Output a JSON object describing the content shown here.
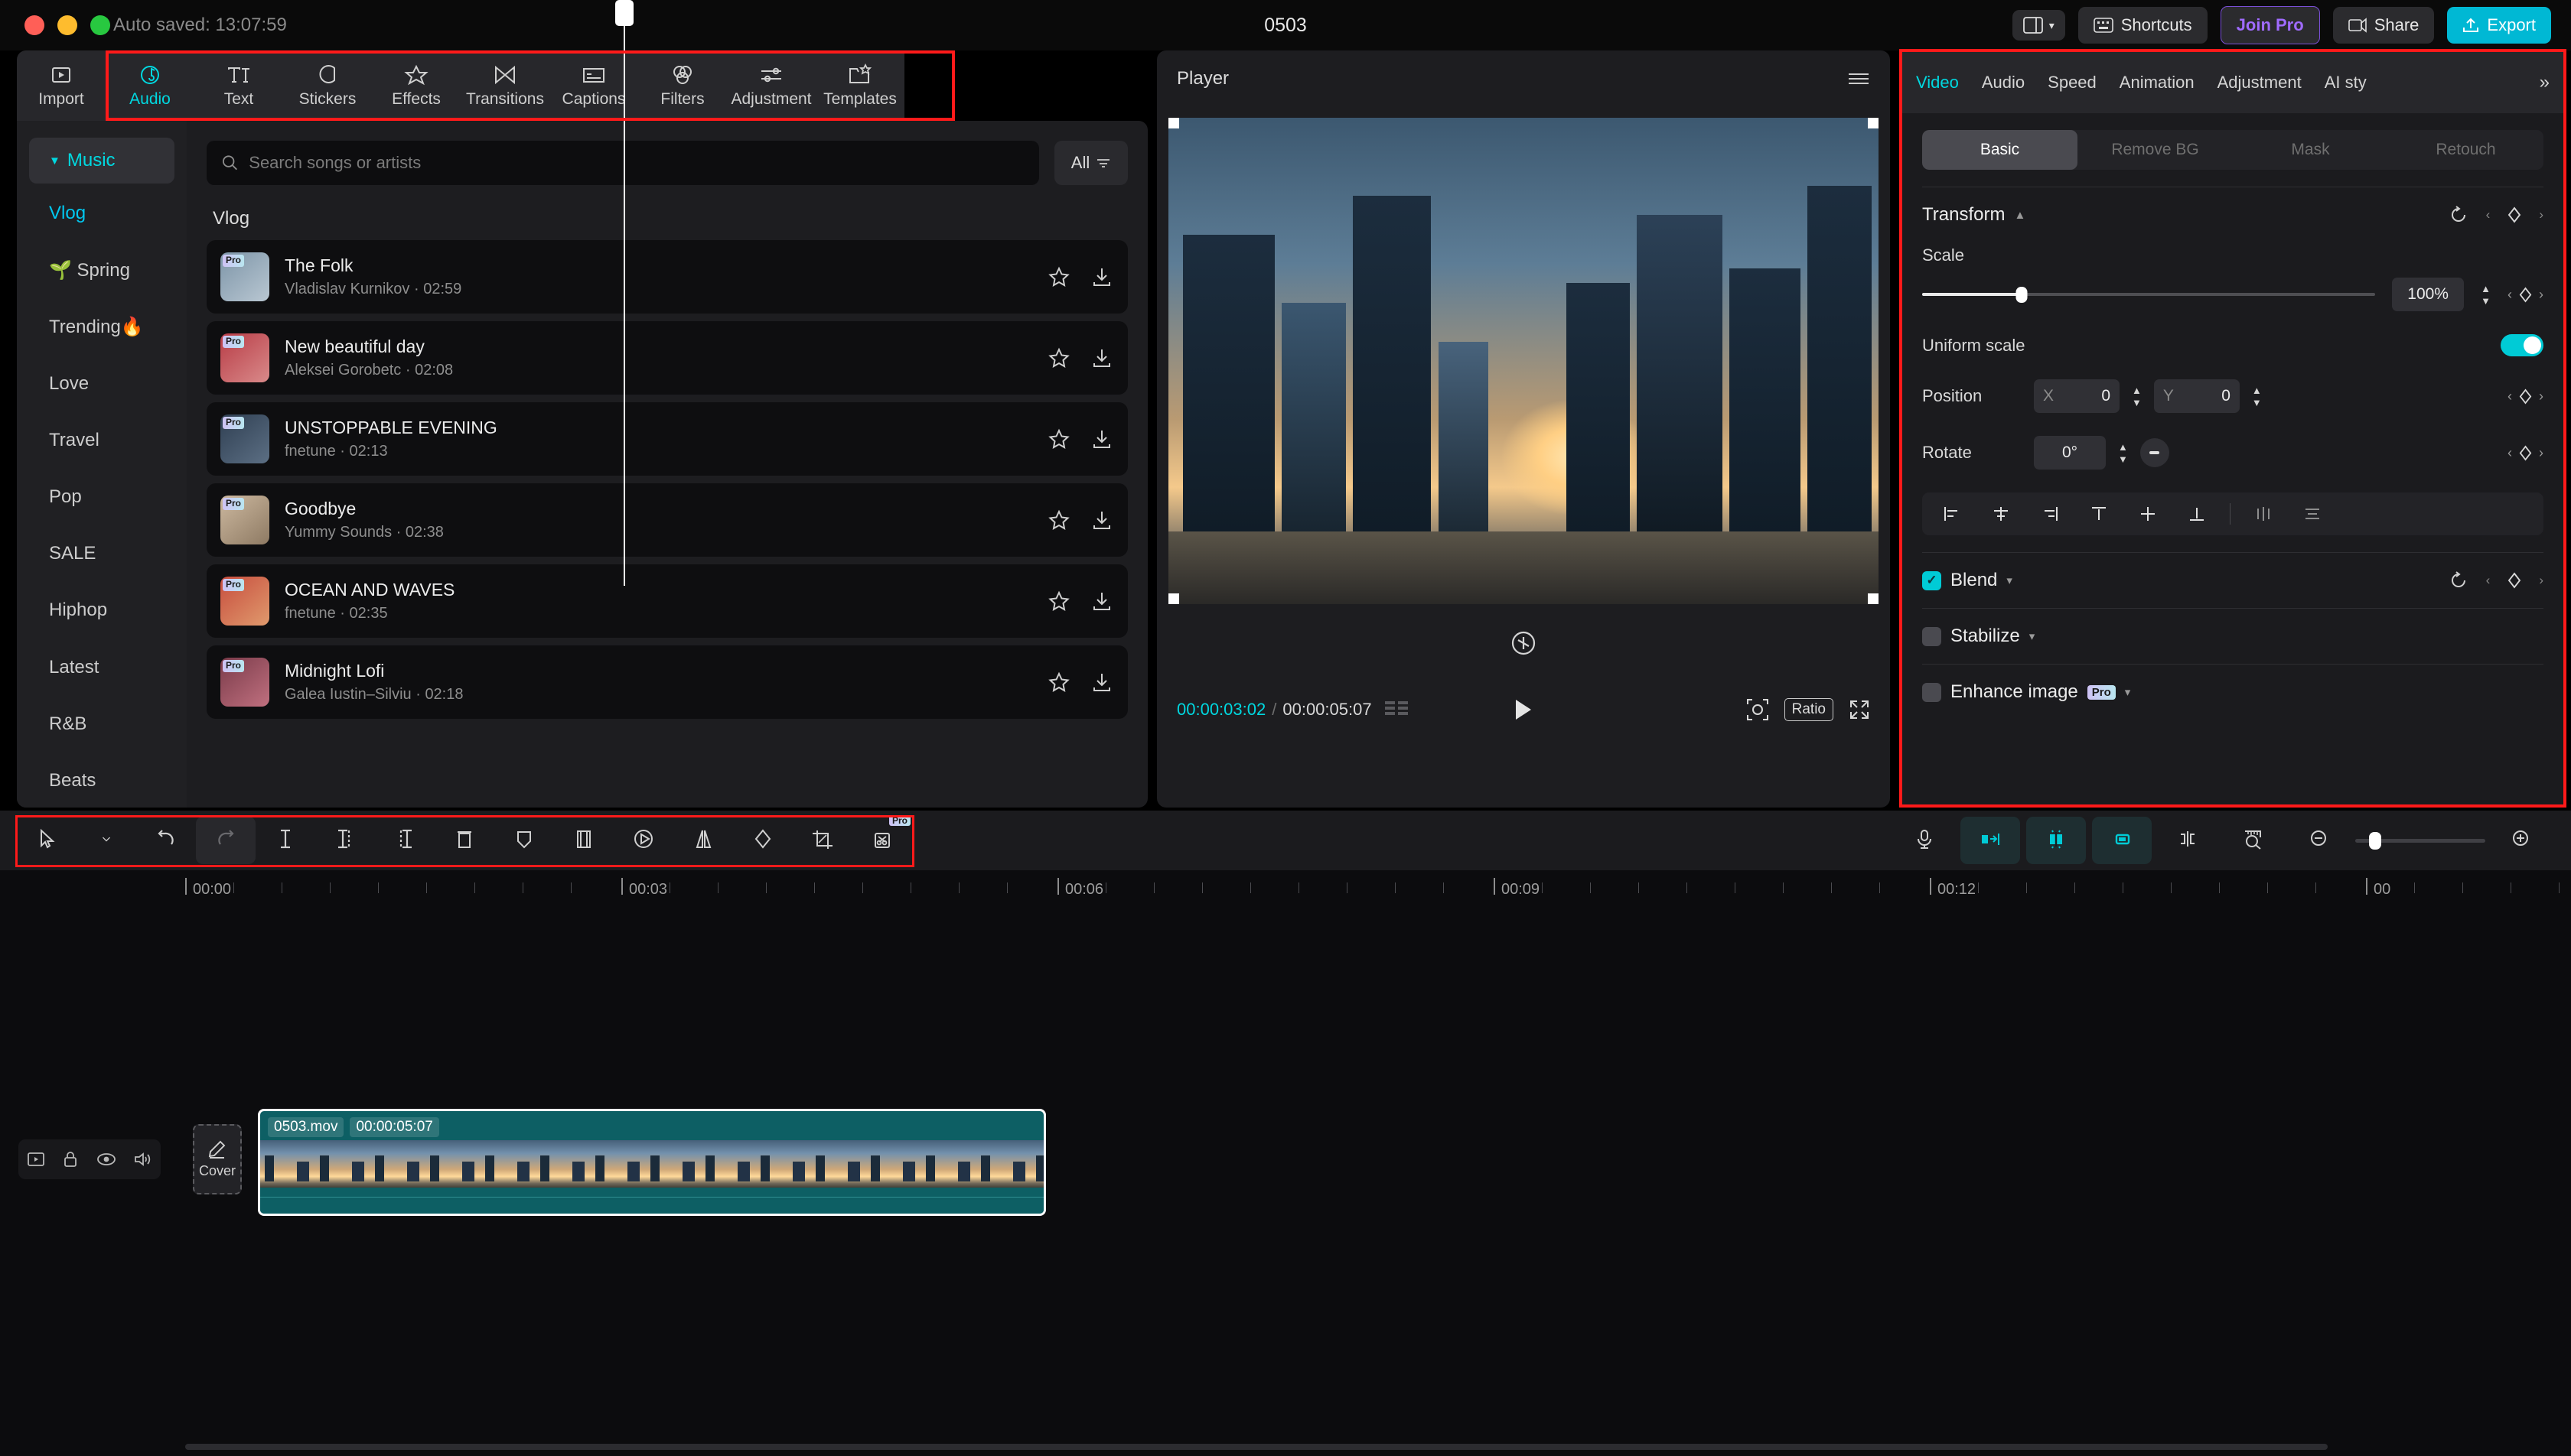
{
  "titlebar": {
    "autosave": "Auto saved: 13:07:59",
    "project_title": "0503",
    "layout_label": "",
    "shortcuts_label": "Shortcuts",
    "join_pro_label": "Join Pro",
    "share_label": "Share",
    "export_label": "Export"
  },
  "toolbar": {
    "tabs": [
      {
        "label": "Import",
        "icon": "import-icon",
        "active": false
      },
      {
        "label": "Audio",
        "icon": "audio-note-icon",
        "active": true
      },
      {
        "label": "Text",
        "icon": "text-icon",
        "active": false
      },
      {
        "label": "Stickers",
        "icon": "sticker-icon",
        "active": false
      },
      {
        "label": "Effects",
        "icon": "effects-star-icon",
        "active": false
      },
      {
        "label": "Transitions",
        "icon": "transitions-icon",
        "active": false
      },
      {
        "label": "Captions",
        "icon": "captions-icon",
        "active": false
      },
      {
        "label": "Filters",
        "icon": "filters-icon",
        "active": false
      },
      {
        "label": "Adjustment",
        "icon": "adjustment-sliders-icon",
        "active": false
      },
      {
        "label": "Templates",
        "icon": "templates-icon",
        "active": false
      }
    ]
  },
  "library": {
    "categories": [
      {
        "label": "Music",
        "type": "head",
        "active": true
      },
      {
        "label": "Vlog",
        "type": "item",
        "active": true
      },
      {
        "label": "🌱 Spring",
        "type": "item",
        "active": false
      },
      {
        "label": "Trending🔥",
        "type": "item",
        "active": false
      },
      {
        "label": "Love",
        "type": "item",
        "active": false
      },
      {
        "label": "Travel",
        "type": "item",
        "active": false
      },
      {
        "label": "Pop",
        "type": "item",
        "active": false
      },
      {
        "label": "SALE",
        "type": "item",
        "active": false
      },
      {
        "label": "Hiphop",
        "type": "item",
        "active": false
      },
      {
        "label": "Latest",
        "type": "item",
        "active": false
      },
      {
        "label": "R&B",
        "type": "item",
        "active": false
      },
      {
        "label": "Beats",
        "type": "item",
        "active": false
      }
    ],
    "search_placeholder": "Search songs or artists",
    "search_value": "",
    "filter_label": "All",
    "group_title": "Vlog",
    "songs": [
      {
        "title": "The Folk",
        "artist": "Vladislav Kurnikov",
        "duration": "02:59",
        "badge": "Pro",
        "color1": "#7d95a8",
        "color2": "#b9c7d2"
      },
      {
        "title": "New beautiful day",
        "artist": "Aleksei Gorobetc",
        "duration": "02:08",
        "badge": "Pro",
        "color1": "#b83c46",
        "color2": "#d98a8a"
      },
      {
        "title": "UNSTOPPABLE EVENING",
        "artist": "fnetune",
        "duration": "02:13",
        "badge": "Pro",
        "color1": "#2f3f52",
        "color2": "#5c6f84"
      },
      {
        "title": "Goodbye",
        "artist": "Yummy Sounds",
        "duration": "02:38",
        "badge": "Pro",
        "color1": "#cdb9a0",
        "color2": "#8e7a63"
      },
      {
        "title": "OCEAN AND WAVES",
        "artist": "fnetune",
        "duration": "02:35",
        "badge": "Pro",
        "color1": "#c74d3e",
        "color2": "#e09a6d"
      },
      {
        "title": "Midnight Lofi",
        "artist": "Galea Iustin–Silviu",
        "duration": "02:18",
        "badge": "Pro",
        "color1": "#7a3b4a",
        "color2": "#c0707f"
      }
    ]
  },
  "player": {
    "title": "Player",
    "current_time": "00:00:03:02",
    "total_time": "00:00:05:07",
    "separator": "/",
    "ratio_label": "Ratio"
  },
  "properties": {
    "tabs": [
      {
        "label": "Video",
        "active": true
      },
      {
        "label": "Audio",
        "active": false
      },
      {
        "label": "Speed",
        "active": false
      },
      {
        "label": "Animation",
        "active": false
      },
      {
        "label": "Adjustment",
        "active": false
      },
      {
        "label": "AI sty",
        "active": false
      }
    ],
    "more_chevron": "»",
    "segments": [
      {
        "label": "Basic",
        "active": true
      },
      {
        "label": "Remove BG",
        "active": false
      },
      {
        "label": "Mask",
        "active": false
      },
      {
        "label": "Retouch",
        "active": false
      }
    ],
    "transform": {
      "title": "Transform",
      "collapse_caret": "▲",
      "scale_label": "Scale",
      "scale_value": "100%",
      "uniform_scale_label": "Uniform scale",
      "uniform_scale_on": true,
      "position_label": "Position",
      "position_x_axis": "X",
      "position_x": "0",
      "position_y_axis": "Y",
      "position_y": "0",
      "rotate_label": "Rotate",
      "rotate_value": "0°"
    },
    "blend": {
      "label": "Blend",
      "checked": true,
      "caret": "▾"
    },
    "stabilize": {
      "label": "Stabilize",
      "checked": false,
      "caret": "▾"
    },
    "enhance": {
      "label": "Enhance image",
      "badge": "Pro",
      "checked": false,
      "caret": "▾"
    }
  },
  "timeline_toolbar": {
    "left_tools": [
      {
        "name": "select-pointer-icon",
        "boxed": false
      },
      {
        "name": "chevron-down-icon",
        "boxed": false
      },
      {
        "name": "undo-icon",
        "boxed": false
      },
      {
        "name": "redo-icon",
        "boxed": true
      },
      {
        "name": "split-icon",
        "boxed": false
      },
      {
        "name": "trim-start-icon",
        "boxed": false
      },
      {
        "name": "trim-end-icon",
        "boxed": false
      },
      {
        "name": "delete-icon",
        "boxed": false
      },
      {
        "name": "marker-icon",
        "boxed": false
      },
      {
        "name": "freeze-frame-icon",
        "boxed": false
      },
      {
        "name": "speed-icon",
        "boxed": false
      },
      {
        "name": "mirror-icon",
        "boxed": false
      },
      {
        "name": "keyframe-icon",
        "boxed": false
      },
      {
        "name": "crop-icon",
        "boxed": false
      },
      {
        "name": "auto-cut-pro-icon",
        "boxed": false,
        "badge": "Pro"
      }
    ],
    "right_tools": [
      {
        "name": "microphone-icon",
        "on": false
      },
      {
        "name": "ripple-left-icon",
        "on": true
      },
      {
        "name": "ripple-center-icon",
        "on": true
      },
      {
        "name": "ripple-right-icon",
        "on": true
      },
      {
        "name": "snap-icon",
        "on": false
      },
      {
        "name": "zoom-to-fit-icon",
        "on": false
      },
      {
        "name": "zoom-out-icon",
        "on": false
      },
      {
        "name": "zoom-in-icon",
        "on": false
      }
    ]
  },
  "timeline": {
    "ruler_labels": [
      "00:00",
      "00:03",
      "00:06",
      "00:09",
      "00:12",
      "00"
    ],
    "playhead_time": "00:03",
    "cover_label": "Cover",
    "track_controls": [
      "track-type-icon",
      "lock-icon",
      "eye-icon",
      "speaker-icon"
    ],
    "clip": {
      "name": "0503.mov",
      "duration": "00:00:05:07",
      "color": "#0d5f64"
    }
  },
  "colors": {
    "accent": "#00d8e0",
    "highlight_box": "#ff1a1a",
    "clip": "#0d5f64",
    "pro": "#a06bff"
  }
}
